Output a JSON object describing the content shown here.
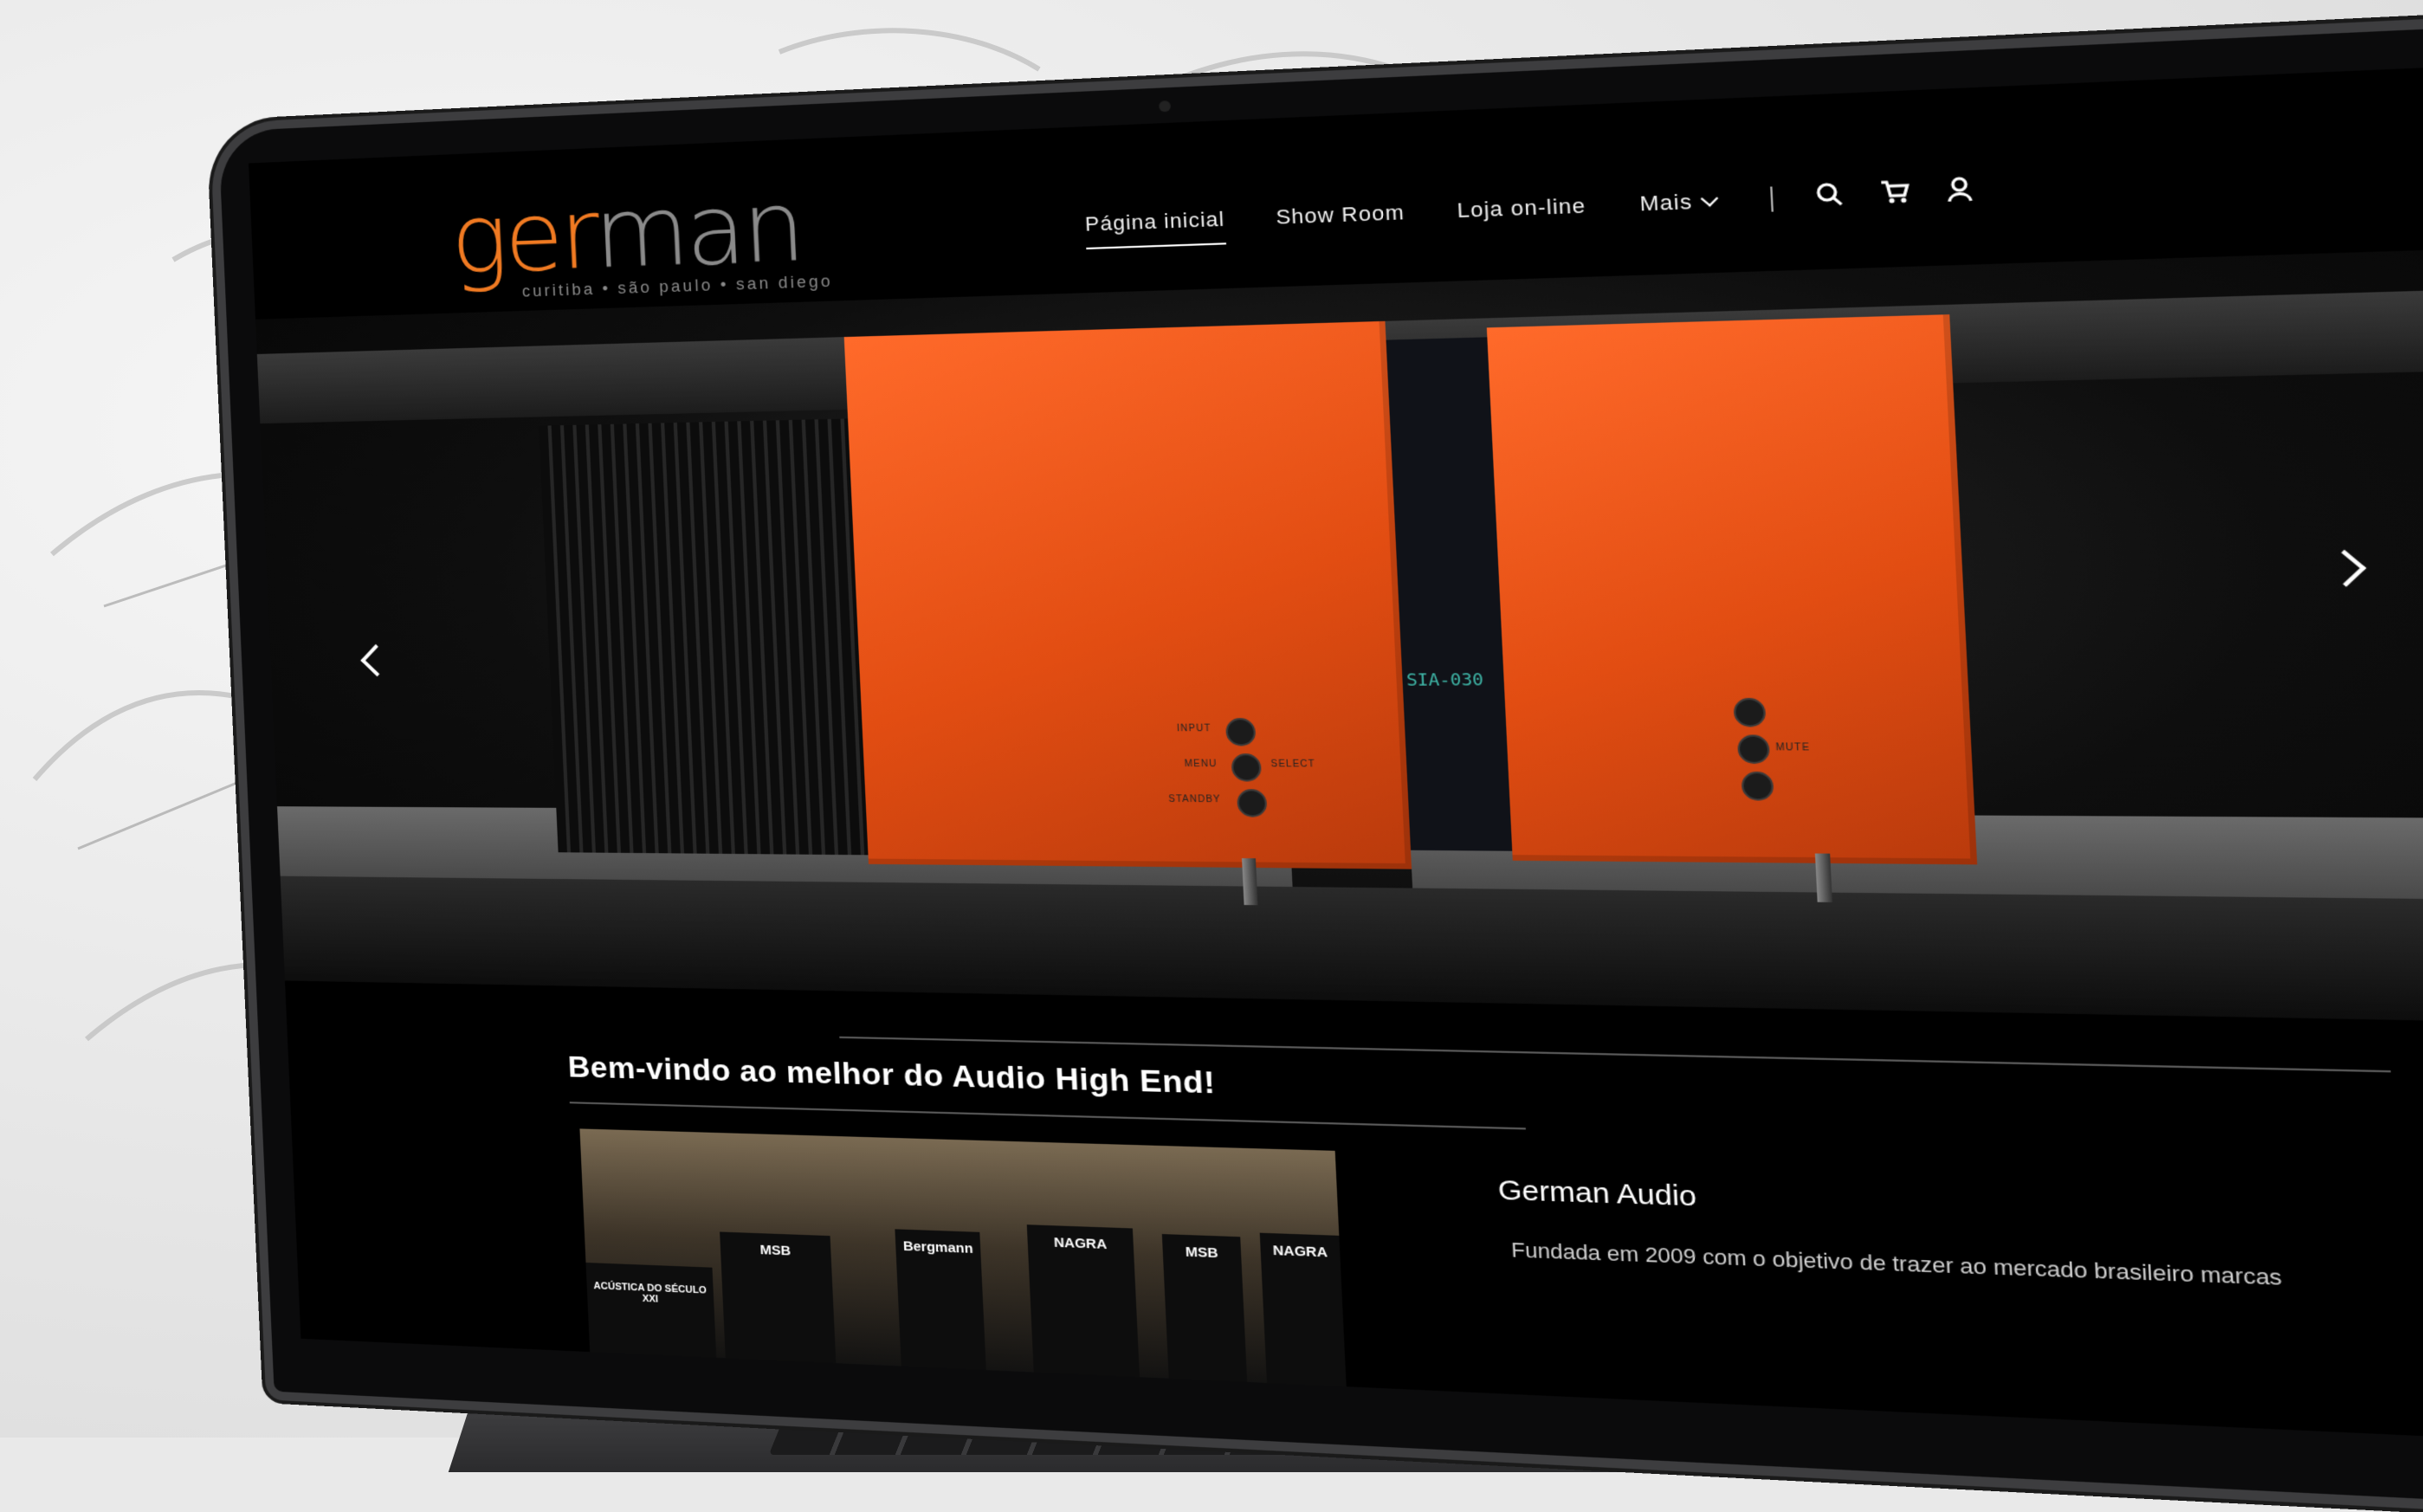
{
  "header": {
    "logo": {
      "part1": "ger",
      "part2": "man",
      "tagline": "curitiba • são paulo • san diego"
    },
    "nav": [
      {
        "label": "Página inicial",
        "active": true
      },
      {
        "label": "Show Room",
        "active": false
      },
      {
        "label": "Loja on-line",
        "active": false
      },
      {
        "label": "Mais",
        "active": false
      }
    ],
    "icons": [
      "search-icon",
      "cart-icon",
      "user-icon"
    ]
  },
  "hero": {
    "display_text": "SIA-030",
    "amp_left_labels": [
      "INPUT",
      "MENU",
      "STANDBY",
      "SELECT"
    ],
    "amp_right_labels": [
      "MUTE"
    ],
    "prev_icon": "chevron-left-icon",
    "next_icon": "chevron-right-icon"
  },
  "content": {
    "welcome": "Bem-vindo ao melhor do Audio High End!",
    "about_title": "German Audio",
    "about_text": "Fundada em 2009 com o objetivo de trazer ao mercado brasileiro marcas",
    "showroom_panels": [
      "MSB",
      "Bergmann",
      "NAGRA",
      "MSB",
      "NAGRA"
    ],
    "showroom_caption": "ACÚSTICA DO SÉCULO XXI"
  },
  "colors": {
    "brand_orange": "#f07a22",
    "amp_orange": "#e24d12",
    "background": "#000000"
  }
}
